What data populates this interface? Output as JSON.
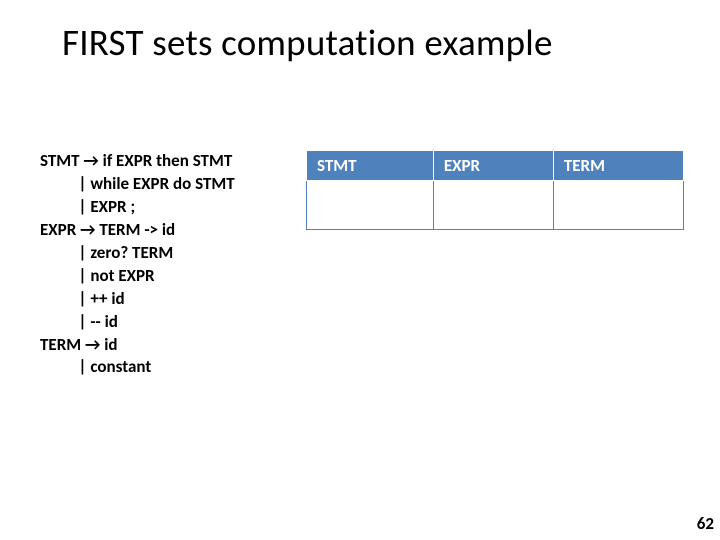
{
  "title": "FIRST sets computation example",
  "grammar": {
    "l1": "STMT → if EXPR then STMT",
    "l2": "          | while EXPR do STMT",
    "l3": "          | EXPR ;",
    "l4": "EXPR → TERM -> id",
    "l5": "          | zero? TERM",
    "l6": "          | not EXPR",
    "l7": "          | ++ id",
    "l8": "          | -- id",
    "l9": "TERM → id",
    "l10": "          | constant"
  },
  "table": {
    "headers": [
      "STMT",
      "EXPR",
      "TERM"
    ]
  },
  "page_number": "62"
}
